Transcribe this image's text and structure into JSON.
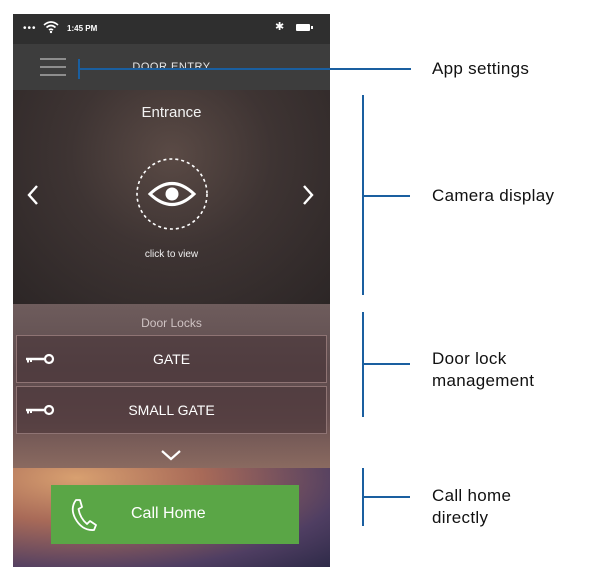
{
  "status_bar": {
    "signal": "•••",
    "time": "1:45 PM",
    "bluetooth": "✱"
  },
  "header": {
    "title": "DOOR ENTRY"
  },
  "camera": {
    "title": "Entrance",
    "caption": "click to view"
  },
  "locks": {
    "title": "Door Locks",
    "items": [
      {
        "label": "GATE"
      },
      {
        "label": "SMALL GATE"
      }
    ]
  },
  "call": {
    "label": "Call Home"
  },
  "annotations": {
    "app_settings": "App settings",
    "camera_display": "Camera display",
    "door_lock_line1": "Door lock",
    "door_lock_line2": "management",
    "call_home_line1": "Call home",
    "call_home_line2": "directly"
  },
  "colors": {
    "call_button": "#5aa646",
    "callout_line": "#1a5fa0",
    "header_bg": "#3d3d3d"
  }
}
